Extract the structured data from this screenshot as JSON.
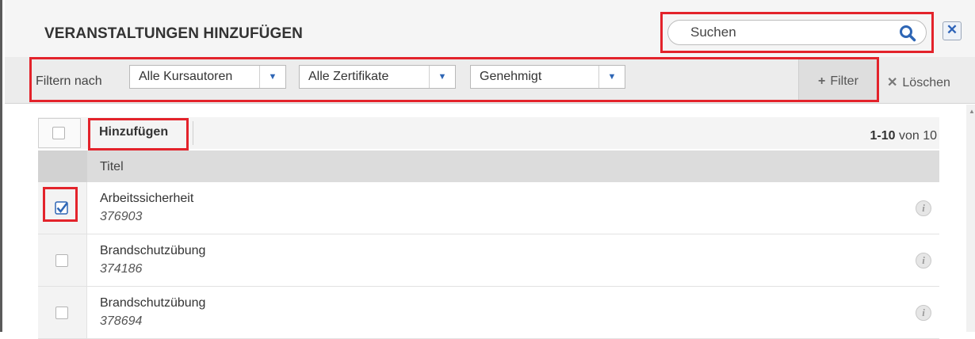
{
  "dialog": {
    "title": "VERANSTALTUNGEN HINZUFÜGEN",
    "search_placeholder": "Suchen",
    "close_label": "✕"
  },
  "filters": {
    "label": "Filtern nach",
    "authors": "Alle Kursautoren",
    "certificates": "Alle Zertifikate",
    "status": "Genehmigt",
    "filter_button": "Filter",
    "clear_button": "Löschen"
  },
  "toolbar": {
    "add_label": "Hinzufügen",
    "pager_range": "1-10",
    "pager_total": "von 10"
  },
  "table": {
    "column_title": "Titel",
    "rows": [
      {
        "title": "Arbeitssicherheit",
        "id": "376903",
        "checked": true
      },
      {
        "title": "Brandschutzübung",
        "id": "374186",
        "checked": false
      },
      {
        "title": "Brandschutzübung",
        "id": "378694",
        "checked": false
      }
    ]
  },
  "icons": {
    "search": "search-icon",
    "close": "close-icon",
    "dropdown": "chevron-down-icon",
    "info": "info-icon",
    "plus": "plus-icon",
    "clear": "x-icon"
  },
  "colors": {
    "accent": "#2e66b5",
    "highlight": "#e3232b"
  }
}
